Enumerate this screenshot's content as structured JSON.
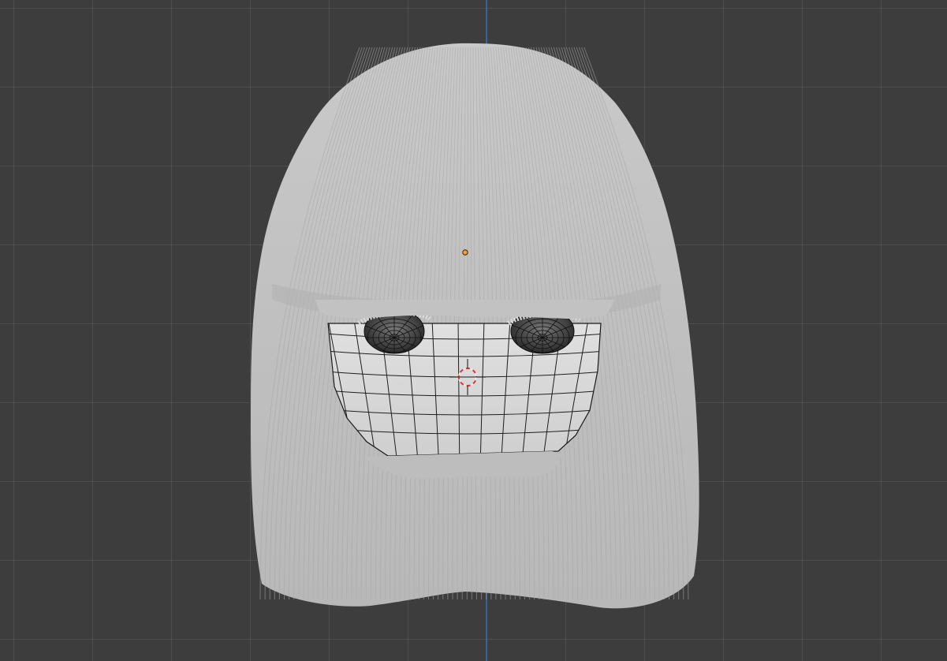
{
  "viewport": {
    "background_color": "#3d3d3d",
    "grid_minor_color": "#444444",
    "grid_major_color": "#505050",
    "z_axis_color": "#3a6fb8"
  },
  "scene": {
    "objects": [
      {
        "name": "hair",
        "color": "#c4c4c4"
      },
      {
        "name": "face-mesh",
        "color": "#d2d2d2",
        "wire_color": "#1a1a1a"
      },
      {
        "name": "left-eye",
        "color": "#3a3a3a"
      },
      {
        "name": "right-eye",
        "color": "#3a3a3a"
      }
    ],
    "icons": {
      "origin": "object-origin-icon",
      "cursor": "3d-cursor-icon"
    }
  }
}
